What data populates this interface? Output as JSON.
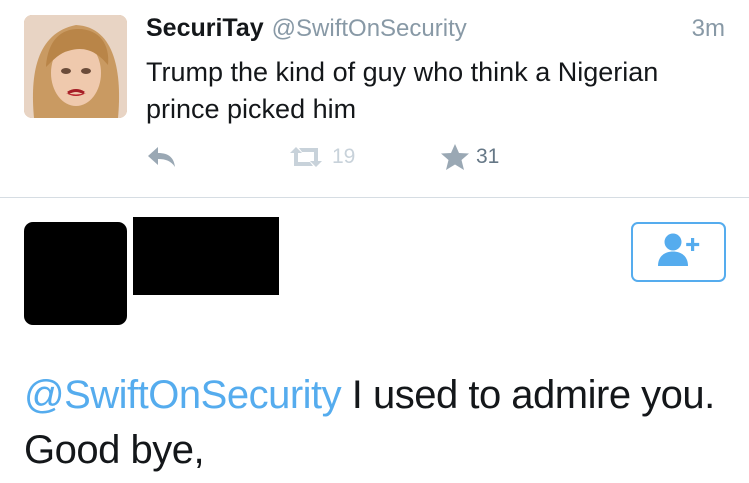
{
  "tweet": {
    "display_name": "SecuriTay",
    "handle": "@SwiftOnSecurity",
    "timestamp": "3m",
    "text": "Trump the kind of guy who think a Nigerian prince picked him",
    "retweet_count": "19",
    "favorite_count": "31",
    "icons": {
      "reply": "reply-icon",
      "retweet": "retweet-icon",
      "favorite": "star-icon"
    }
  },
  "reply": {
    "mention": "@SwiftOnSecurity",
    "text": " I used to admire you. Good bye,",
    "follow_icon": "add-user-icon"
  },
  "colors": {
    "link_blue": "#55acee",
    "meta_gray": "#8899a6",
    "icon_gray": "#9aa8b4",
    "divider": "#d6dde3"
  }
}
